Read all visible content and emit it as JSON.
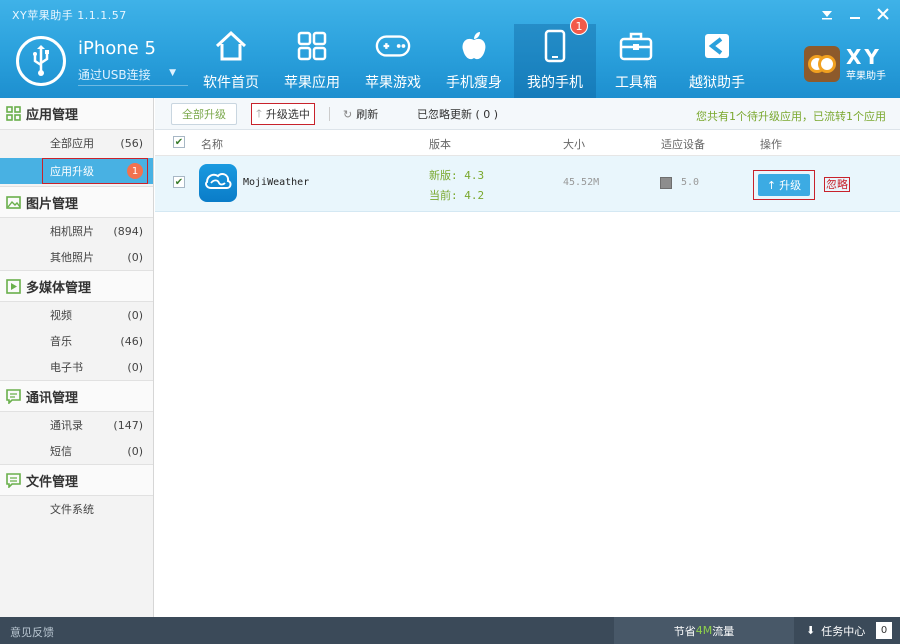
{
  "window": {
    "title": "XY苹果助手 1.1.1.57"
  },
  "device": {
    "name": "iPhone 5",
    "connection": "通过USB连接"
  },
  "nav_tabs": [
    {
      "label": "软件首页",
      "icon": "home-icon"
    },
    {
      "label": "苹果应用",
      "icon": "apps-grid-icon"
    },
    {
      "label": "苹果游戏",
      "icon": "gamepad-icon"
    },
    {
      "label": "手机瘦身",
      "icon": "apple-icon"
    },
    {
      "label": "我的手机",
      "icon": "phone-icon",
      "badge": "1",
      "active": true
    },
    {
      "label": "工具箱",
      "icon": "toolbox-icon"
    },
    {
      "label": "越狱助手",
      "icon": "jailbreak-icon"
    }
  ],
  "brand": {
    "logo": "XY",
    "sub": "苹果助手"
  },
  "sidebar": {
    "sections": [
      {
        "title": "应用管理",
        "icon": "apps-icon",
        "items": [
          {
            "label": "全部应用",
            "count": "(56)"
          },
          {
            "label": "应用升级",
            "count": "1",
            "active": true
          }
        ]
      },
      {
        "title": "图片管理",
        "icon": "picture-icon",
        "items": [
          {
            "label": "相机照片",
            "count": "(894)"
          },
          {
            "label": "其他照片",
            "count": "(0)"
          }
        ]
      },
      {
        "title": "多媒体管理",
        "icon": "media-icon",
        "items": [
          {
            "label": "视频",
            "count": "(0)"
          },
          {
            "label": "音乐",
            "count": "(46)"
          },
          {
            "label": "电子书",
            "count": "(0)"
          }
        ]
      },
      {
        "title": "通讯管理",
        "icon": "chat-icon",
        "items": [
          {
            "label": "通讯录",
            "count": "(147)"
          },
          {
            "label": "短信",
            "count": "(0)"
          }
        ]
      },
      {
        "title": "文件管理",
        "icon": "file-icon",
        "items": [
          {
            "label": "文件系统",
            "count": ""
          }
        ]
      }
    ]
  },
  "toolbar": {
    "upgrade_all": "全部升级",
    "upgrade_selected": "升级选中",
    "refresh": "刷新",
    "ignored": "已忽略更新 ( 0 )",
    "info": "您共有1个待升级应用，已流转1个应用"
  },
  "table": {
    "columns": {
      "name": "名称",
      "version": "版本",
      "size": "大小",
      "device": "适应设备",
      "action": "操作"
    },
    "rows": [
      {
        "name": "MojiWeather",
        "new_version": "新版: 4.3",
        "current_version": "当前: 4.2",
        "size": "45.52M",
        "device_version": "5.0",
        "upgrade_label": "升级",
        "ignore_label": "忽略",
        "checked": true
      }
    ]
  },
  "statusbar": {
    "feedback": "意见反馈",
    "traffic_prefix": "节省",
    "traffic_value": "4M",
    "traffic_suffix": "流量",
    "task_center": "任务中心",
    "task_count": "0"
  }
}
